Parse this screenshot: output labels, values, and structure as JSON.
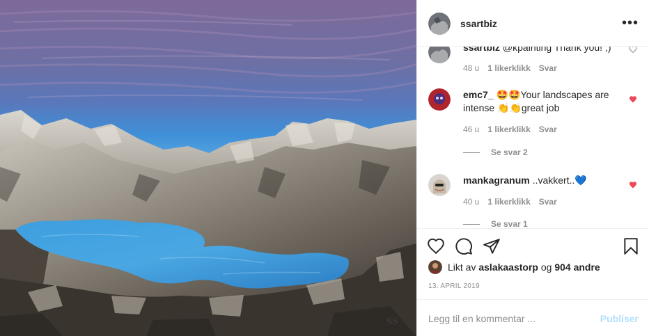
{
  "post": {
    "owner": "ssartbiz",
    "artwork_signature": "SS",
    "more_icon": "•••"
  },
  "comments": [
    {
      "user": "ssartbiz",
      "text": "@kpainting Thank you! ;)",
      "time": "48 u",
      "likes": "1 likerklikk",
      "reply": "Svar",
      "liked": false
    },
    {
      "user": "emc7_",
      "text": "🤩🤩Your landscapes are intense 👏👏great job",
      "time": "46 u",
      "likes": "1 likerklikk",
      "reply": "Svar",
      "liked": true,
      "view_replies": "Se svar 2"
    },
    {
      "user": "mankagranum",
      "text": "..vakkert..💙",
      "time": "40 u",
      "likes": "1 likerklikk",
      "reply": "Svar",
      "liked": true,
      "view_replies": "Se svar 1"
    }
  ],
  "likes_line": {
    "prefix": "Likt av",
    "user": "aslakaastorp",
    "joiner": "og",
    "others": "904 andre"
  },
  "date": "13. APRIL 2019",
  "add_comment": {
    "placeholder": "Legg til en kommentar ...",
    "publish": "Publiser"
  },
  "colors": {
    "heart_red": "#ed4956",
    "publish_disabled": "#b2dffc",
    "meta_grey": "#8e8e8e"
  },
  "icons": [
    "more-options-icon",
    "heart-icon",
    "comment-icon",
    "share-icon",
    "bookmark-icon",
    "like-heart-icon"
  ]
}
